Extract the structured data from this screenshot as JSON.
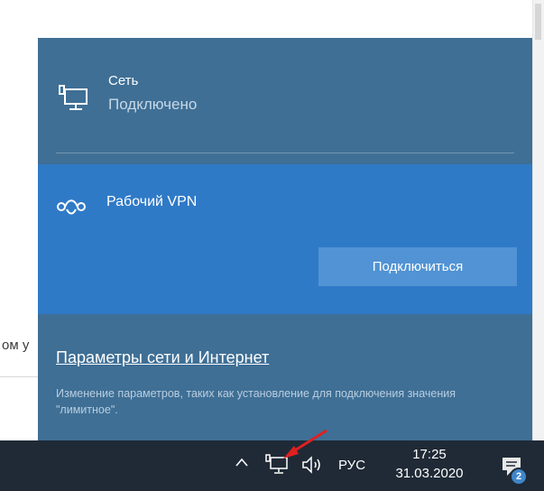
{
  "background": {
    "partial_text": "ом у"
  },
  "flyout": {
    "network": {
      "name": "Сеть",
      "status": "Подключено",
      "icon": "wired-network-icon"
    },
    "vpn": {
      "name": "Рабочий VPN",
      "icon": "vpn-icon",
      "connect_label": "Подключиться"
    },
    "settings": {
      "link_label": "Параметры сети и Интернет",
      "description": "Изменение параметров, таких как установление для подключения значения \"лимитное\"."
    }
  },
  "taskbar": {
    "language": "РУС",
    "time": "17:25",
    "date": "31.03.2020",
    "notification_count": "2",
    "icons": [
      "chevron-up-icon",
      "network-icon",
      "volume-icon",
      "notification-icon"
    ]
  },
  "colors": {
    "flyout_bg": "#3f6f95",
    "vpn_bg": "#2f7ac7",
    "button_bg": "#5193d4",
    "taskbar_bg": "#1f2a36",
    "arrow": "#e02020"
  }
}
